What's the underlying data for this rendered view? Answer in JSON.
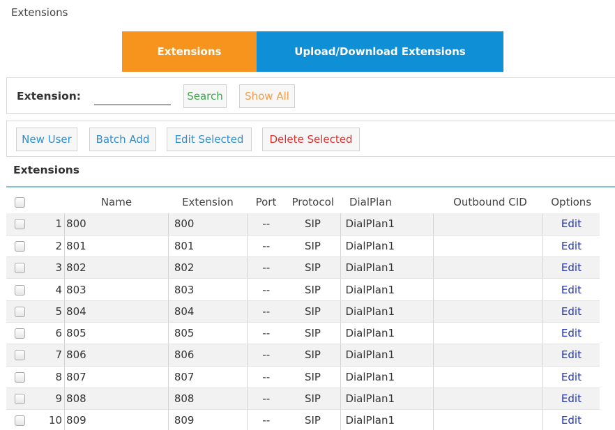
{
  "breadcrumb": "Extensions",
  "tabs": [
    {
      "label": "Extensions",
      "active": true,
      "color": "#f7941e"
    },
    {
      "label": "Upload/Download Extensions",
      "active": false,
      "color": "#0e8fd6"
    }
  ],
  "search": {
    "label": "Extension:",
    "value": "",
    "search_button": "Search",
    "show_all_button": "Show All"
  },
  "actions": {
    "new_user": "New User",
    "batch_add": "Batch Add",
    "edit_selected": "Edit Selected",
    "delete_selected": "Delete Selected"
  },
  "table": {
    "title": "Extensions",
    "columns": {
      "name": "Name",
      "extension": "Extension",
      "port": "Port",
      "protocol": "Protocol",
      "dialplan": "DialPlan",
      "outbound_cid": "Outbound CID",
      "options": "Options"
    },
    "rows": [
      {
        "num": "1",
        "name": "800",
        "extension": "800",
        "port": "--",
        "protocol": "SIP",
        "dialplan": "DialPlan1",
        "outbound_cid": "",
        "option": "Edit"
      },
      {
        "num": "2",
        "name": "801",
        "extension": "801",
        "port": "--",
        "protocol": "SIP",
        "dialplan": "DialPlan1",
        "outbound_cid": "",
        "option": "Edit"
      },
      {
        "num": "3",
        "name": "802",
        "extension": "802",
        "port": "--",
        "protocol": "SIP",
        "dialplan": "DialPlan1",
        "outbound_cid": "",
        "option": "Edit"
      },
      {
        "num": "4",
        "name": "803",
        "extension": "803",
        "port": "--",
        "protocol": "SIP",
        "dialplan": "DialPlan1",
        "outbound_cid": "",
        "option": "Edit"
      },
      {
        "num": "5",
        "name": "804",
        "extension": "804",
        "port": "--",
        "protocol": "SIP",
        "dialplan": "DialPlan1",
        "outbound_cid": "",
        "option": "Edit"
      },
      {
        "num": "6",
        "name": "805",
        "extension": "805",
        "port": "--",
        "protocol": "SIP",
        "dialplan": "DialPlan1",
        "outbound_cid": "",
        "option": "Edit"
      },
      {
        "num": "7",
        "name": "806",
        "extension": "806",
        "port": "--",
        "protocol": "SIP",
        "dialplan": "DialPlan1",
        "outbound_cid": "",
        "option": "Edit"
      },
      {
        "num": "8",
        "name": "807",
        "extension": "807",
        "port": "--",
        "protocol": "SIP",
        "dialplan": "DialPlan1",
        "outbound_cid": "",
        "option": "Edit"
      },
      {
        "num": "9",
        "name": "808",
        "extension": "808",
        "port": "--",
        "protocol": "SIP",
        "dialplan": "DialPlan1",
        "outbound_cid": "",
        "option": "Edit"
      },
      {
        "num": "10",
        "name": "809",
        "extension": "809",
        "port": "--",
        "protocol": "SIP",
        "dialplan": "DialPlan1",
        "outbound_cid": "",
        "option": "Edit"
      }
    ]
  }
}
